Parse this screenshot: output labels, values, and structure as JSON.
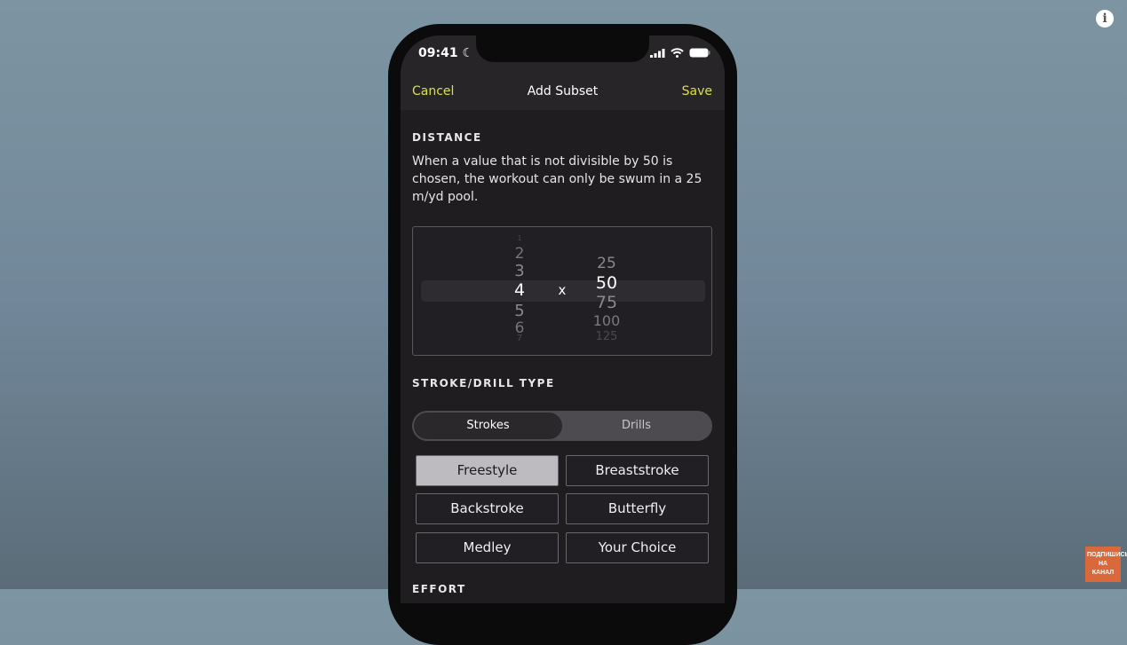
{
  "status": {
    "time": "09:41"
  },
  "nav": {
    "cancel": "Cancel",
    "title": "Add Subset",
    "save": "Save"
  },
  "distance": {
    "label": "DISTANCE",
    "description": "When a value that is not divisible by 50 is chosen, the workout can only be swum in a 25 m/yd pool.",
    "reps": [
      "1",
      "2",
      "3",
      "4",
      "5",
      "6",
      "7"
    ],
    "reps_selected": "4",
    "times": "x",
    "lengths": [
      "25",
      "50",
      "75",
      "100",
      "125"
    ],
    "length_selected": "50"
  },
  "stroke": {
    "label": "STROKE/DRILL TYPE",
    "segments": [
      "Strokes",
      "Drills"
    ],
    "selected_segment": "Strokes",
    "options": [
      "Freestyle",
      "Breaststroke",
      "Backstroke",
      "Butterfly",
      "Medley",
      "Your Choice"
    ],
    "selected": "Freestyle"
  },
  "effort": {
    "label": "EFFORT"
  },
  "overlay": {
    "subscribe": "ПОДПИШИСЬ НА КАНАЛ",
    "info": "i"
  },
  "colors": {
    "accent": "#d7e04a",
    "background": "#1f1d20"
  }
}
